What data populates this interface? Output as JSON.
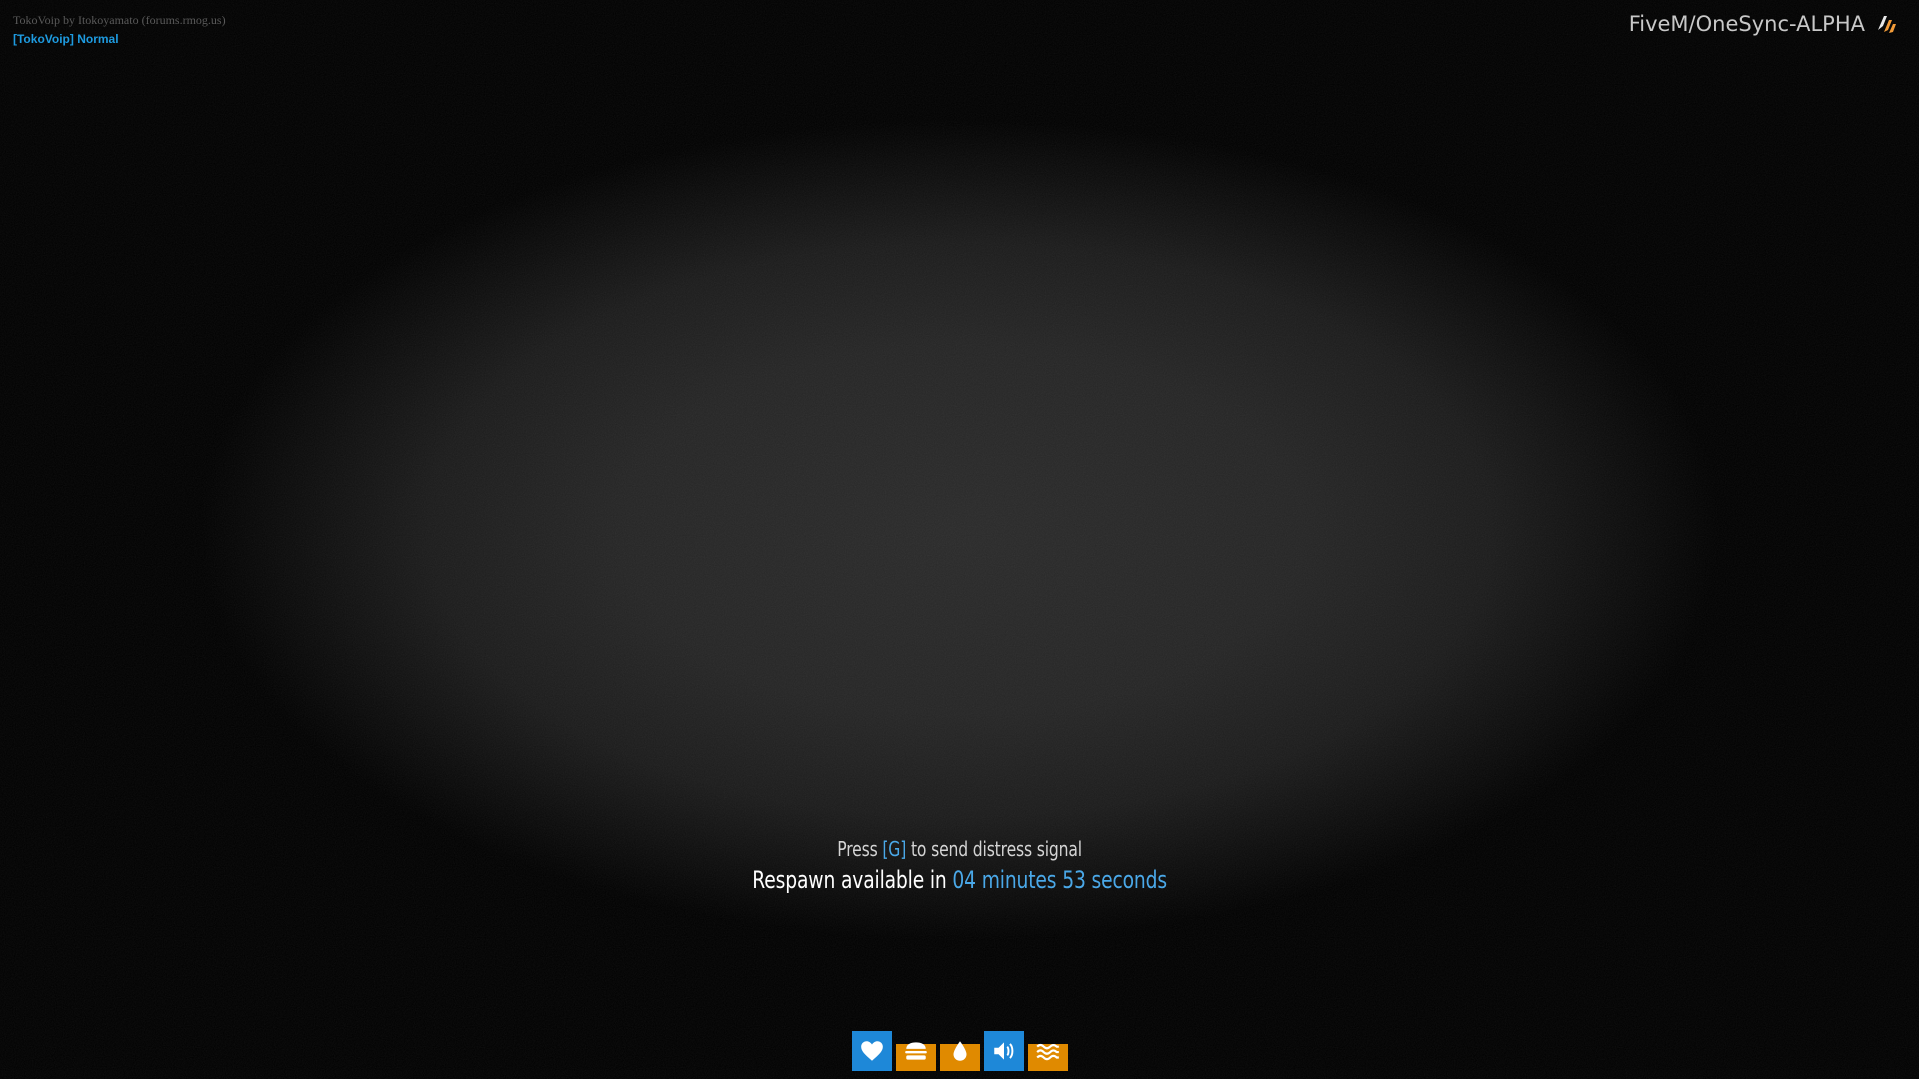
{
  "overlay": {
    "voip_credit": "TokoVoip by Itokoyamato (forums.rmog.us)",
    "voip_status": "[TokoVoip] Normal",
    "server_brand": "FiveM/OneSync-ALPHA"
  },
  "death_screen": {
    "distress": {
      "prefix": "Press ",
      "key": "[G]",
      "suffix": " to send distress signal"
    },
    "respawn": {
      "prefix": "Respawn available in ",
      "timer": "04 minutes 53 seconds"
    }
  },
  "hud": {
    "icons": [
      "heart-icon",
      "hamburger-icon",
      "water-drop-icon",
      "speaker-icon",
      "water-waves-icon"
    ],
    "levels": {
      "health": 1.0,
      "hunger": 0.68,
      "thirst": 0.68,
      "voice": 1.0,
      "stamina": 0.68
    }
  },
  "colors": {
    "accent_blue": "#1e88d8",
    "accent_orange": "#e08a00",
    "highlight_text": "#4aa8e8",
    "voip_status": "#1e9be0"
  }
}
